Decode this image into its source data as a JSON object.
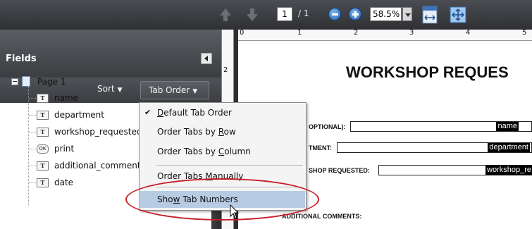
{
  "toolbar": {
    "page_current": "1",
    "page_total": "/ 1",
    "zoom_value": "58.5%"
  },
  "panel": {
    "title": "Fields",
    "sort_label": "Sort",
    "tab_order_label": "Tab Order",
    "caret": "▼"
  },
  "tree": {
    "page": "Page 1",
    "items": [
      {
        "label": "name",
        "icon": "T"
      },
      {
        "label": "department",
        "icon": "T"
      },
      {
        "label": "workshop_requested",
        "icon": "T"
      },
      {
        "label": "print",
        "icon": "OK"
      },
      {
        "label": "additional_comments",
        "icon": "T"
      },
      {
        "label": "date",
        "icon": "T"
      }
    ]
  },
  "menu": {
    "default_check": "✔",
    "items": [
      {
        "pre": "",
        "key": "D",
        "post": "efault Tab Order"
      },
      {
        "pre": "Order Tabs by ",
        "key": "R",
        "post": "ow"
      },
      {
        "pre": "Order Tabs by ",
        "key": "C",
        "post": "olumn"
      },
      {
        "pre": "Order Tabs ",
        "key": "M",
        "post": "anually"
      },
      {
        "pre": "Sho",
        "key": "w",
        "post": " Tab Numbers"
      }
    ]
  },
  "ruler": {
    "h_numbers": [
      "0",
      "1",
      "2",
      "3",
      "4",
      "5"
    ],
    "v_number": "2"
  },
  "document": {
    "title": "WORKSHOP REQUES",
    "labels": [
      "OPTIONAL):",
      "TMENT:",
      "SHOP REQUESTED:",
      "ADDITIONAL COMMENTS:"
    ],
    "fields": [
      "name",
      "department",
      "workshop_re"
    ]
  }
}
